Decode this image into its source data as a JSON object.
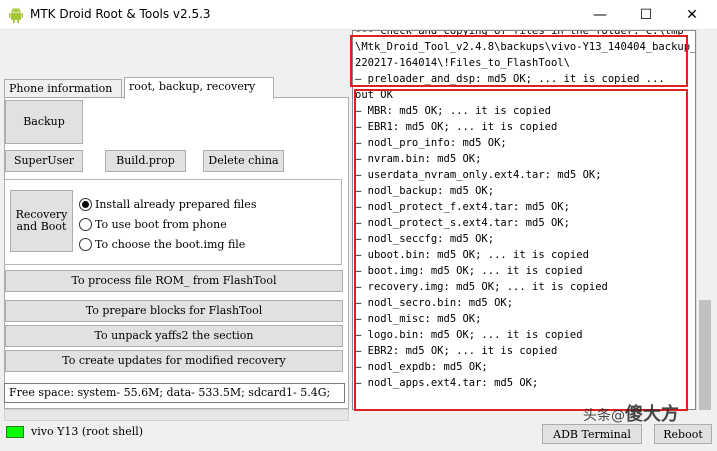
{
  "window": {
    "title": "MTK Droid Root & Tools v2.5.3",
    "minimize_glyph": "—",
    "maximize_glyph": "☐",
    "close_glyph": "✕"
  },
  "tabs": [
    {
      "label": "Phone information",
      "active": false
    },
    {
      "label": "root, backup, recovery",
      "active": true
    }
  ],
  "buttons": {
    "backup": "Backup",
    "superuser": "SuperUser",
    "build_prop": "Build.prop",
    "delete_china": "Delete china",
    "recovery_and_boot": "Recovery and Boot",
    "process_rom": "To process file ROM_ from FlashTool",
    "prepare_blocks": "To prepare blocks for FlashTool",
    "unpack_yaffs2": "To unpack yaffs2 the section",
    "create_updates": "To create updates for modified recovery",
    "adb_terminal": "ADB Terminal",
    "reboot": "Reboot"
  },
  "recovery_options": [
    {
      "label": "Install already prepared files",
      "checked": true
    },
    {
      "label": "To use boot from phone",
      "checked": false
    },
    {
      "label": "To choose the boot.img file",
      "checked": false
    }
  ],
  "free_space": "Free space: system- 55.6M; data- 533.5M; sdcard1- 5.4G;",
  "status": {
    "device": "vivo Y13 (root shell)",
    "led_color": "#00ff00"
  },
  "log_lines": [
    " --- Check and copying of files in the folder: C:\\tmp",
    "\\Mtk_Droid_Tool_v2.4.8\\backups\\vivo-Y13_140404_backup_",
    "220217-164014\\!Files_to_FlashTool\\",
    "  — preloader_and_dsp: md5 OK;  ... it is copied ...",
    "out OK",
    "  — MBR: md5 OK;  ... it is copied",
    "  — EBR1: md5 OK;  ... it is copied",
    "  — nodl_pro_info: md5 OK;",
    "  — nvram.bin: md5 OK;",
    "  — userdata_nvram_only.ext4.tar: md5 OK;",
    "  — nodl_backup: md5 OK;",
    "  — nodl_protect_f.ext4.tar: md5 OK;",
    "  — nodl_protect_s.ext4.tar: md5 OK;",
    "  — nodl_seccfg: md5 OK;",
    "  — uboot.bin: md5 OK;  ... it is copied",
    "  — boot.img: md5 OK;  ... it is copied",
    "  — recovery.img: md5 OK;  ... it is copied",
    "  — nodl_secro.bin: md5 OK;",
    "  — nodl_misc: md5 OK;",
    "  — logo.bin: md5 OK;  ... it is copied",
    "  — EBR2: md5 OK;  ... it is copied",
    "  — nodl_expdb: md5 OK;",
    "  — nodl_apps.ext4.tar: md5 OK;"
  ],
  "watermark": {
    "prefix": "头条",
    "mid": "@",
    "brand": "傻大方"
  },
  "colors": {
    "highlight_box": "#e02020",
    "status_led": "#00ff00",
    "android_icon": "#a4c639"
  }
}
